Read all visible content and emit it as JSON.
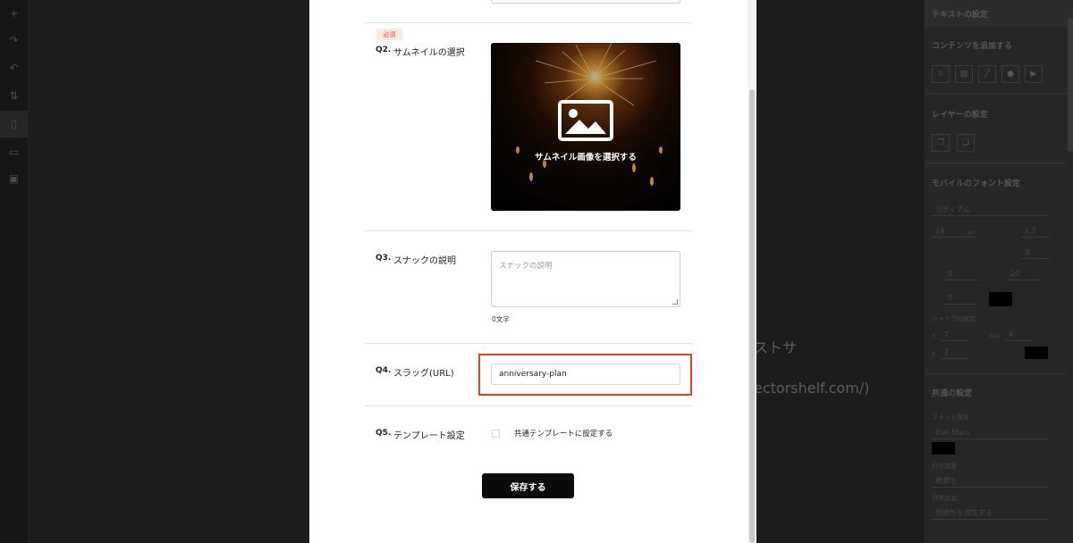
{
  "left_toolbar": {
    "items": [
      {
        "icon": "plus-icon",
        "glyph": "+"
      },
      {
        "icon": "redo-icon",
        "glyph": "↷"
      },
      {
        "icon": "undo-icon",
        "glyph": "↶"
      },
      {
        "icon": "sort-icon",
        "glyph": "⇅"
      },
      {
        "icon": "mobile-icon",
        "glyph": "▯"
      },
      {
        "icon": "desktop-icon",
        "glyph": "▭"
      },
      {
        "icon": "save-icon",
        "glyph": "▣"
      }
    ]
  },
  "canvas": {
    "text_partial_1": "ストサ",
    "text_partial_2": "ectorshelf.com/)"
  },
  "right_panel": {
    "header": "テキストの設定",
    "content_title": "コンテンツを追加する",
    "layer_title": "レイヤーの設定",
    "mobile_font_title": "モバイルのフォント設定",
    "font_weight": "ミディアム",
    "font_size": "24",
    "font_size_unit": "px",
    "line_height": "1.5",
    "letter_spacing": "0",
    "rotation": "0",
    "rotation_unit": "°",
    "radius": "20",
    "radius_unit": "px",
    "border_width": "0",
    "border_unit": "px",
    "shadow_title": "シャドウの設定",
    "shadow_x_label": "x",
    "shadow_x": "7",
    "shadow_y_label": "y",
    "shadow_y": "7",
    "shadow_blur_label": "blur",
    "shadow_blur": "4",
    "px": "px",
    "common_title": "共通の設定",
    "font_setting_label": "フォント設定",
    "font_name": "Kiwi Maru",
    "row_setting_label": "行の設定",
    "writing_mode": "横書き",
    "bg_setting_label": "背景設定",
    "bg_option": "背景色を指定する"
  },
  "form": {
    "required_badge": "必須",
    "q2": {
      "num": "Q2.",
      "label": "サムネイルの選択",
      "thumb_text": "サムネイル画像を選択する"
    },
    "q3": {
      "num": "Q3.",
      "label": "スナックの説明",
      "placeholder": "スナックの説明",
      "char_count": "0文字"
    },
    "q4": {
      "num": "Q4.",
      "label": "スラッグ(URL)",
      "value": "anniversary-plan"
    },
    "q5": {
      "num": "Q5.",
      "label": "テンプレート設定",
      "checkbox_label": "共通テンプレートに設定する",
      "checked": false
    },
    "save_label": "保存する"
  },
  "colors": {
    "highlight": "#e2401f",
    "required_bg": "#fde6e3",
    "required_text": "#e04b3b",
    "save_bg": "#0b0b0b"
  }
}
